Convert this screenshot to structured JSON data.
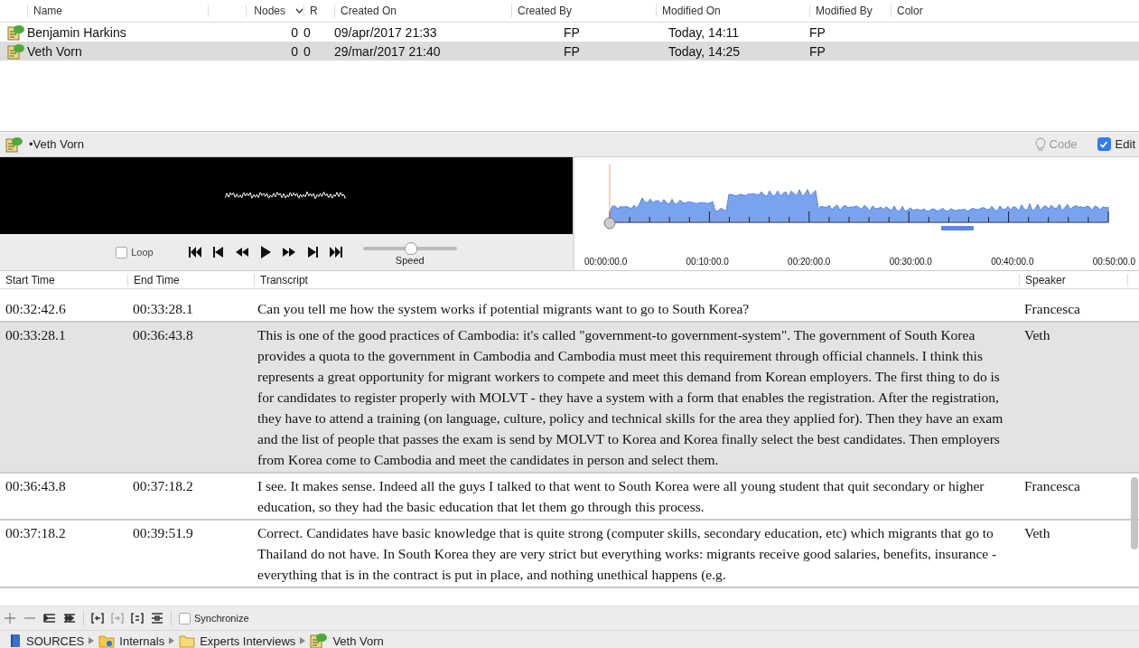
{
  "sources_table": {
    "columns": [
      {
        "label": "Name",
        "sorted": false
      },
      {
        "label": "Nodes",
        "sorted": true
      },
      {
        "label": "R",
        "sorted": false
      },
      {
        "label": "Created On",
        "sorted": false
      },
      {
        "label": "Created By",
        "sorted": false
      },
      {
        "label": "Modified On",
        "sorted": false
      },
      {
        "label": "Modified By",
        "sorted": false
      },
      {
        "label": "Color",
        "sorted": false
      }
    ],
    "rows": [
      {
        "name": "Benjamin Harkins",
        "nodes": "0",
        "r": "0",
        "created_on": "09/apr/2017 21:33",
        "created_by": "FP",
        "modified_on": "Today, 14:11",
        "modified_by": "FP",
        "selected": false
      },
      {
        "name": "Veth Vorn",
        "nodes": "0",
        "r": "0",
        "created_on": "29/mar/2017 21:40",
        "created_by": "FP",
        "modified_on": "Today, 14:25",
        "modified_by": "FP",
        "selected": true
      }
    ]
  },
  "document": {
    "title": "•Veth Vorn",
    "code": {
      "label": "Code"
    },
    "edit": {
      "label": "Edit",
      "checked": true
    }
  },
  "player": {
    "loop": {
      "label": "Loop",
      "checked": false
    },
    "speed": {
      "label": "Speed",
      "level": 0.5
    }
  },
  "timeline": {
    "labels": [
      "00:00:00.0",
      "00:10:00.0",
      "00:20:00.0",
      "00:30:00.0",
      "00:40:00.0",
      "00:50:00.0"
    ]
  },
  "transcript": {
    "columns": [
      "Start Time",
      "End Time",
      "Transcript",
      "Speaker"
    ],
    "rows": [
      {
        "start": "00:32:42.6",
        "end": "00:33:28.1",
        "text": "Can you tell me how the system works if potential migrants want to go to South Korea?",
        "speaker": "Francesca",
        "selected": false
      },
      {
        "start": "00:33:28.1",
        "end": "00:36:43.8",
        "text": "This is one of the good practices of Cambodia: it's called \"government-to government-system\". The government of South Korea provides a quota to the government in Cambodia and Cambodia must meet this requirement through official channels. I think this represents a great opportunity for migrant workers to compete and meet this demand from Korean employers. The first thing to do is for candidates to register properly with MOLVT - they have a system with a form that enables the registration. After the registration, they have to attend a training (on language, culture, policy and technical skills for the area they applied for). Then they have an exam and the list of people that passes the exam is send by MOLVT to Korea and Korea finally select the best candidates. Then employers from Korea come to Cambodia and meet the candidates in person and select them.",
        "speaker": "Veth",
        "selected": true
      },
      {
        "start": "00:36:43.8",
        "end": "00:37:18.2",
        "text": "I see. It makes sense. Indeed all the guys I talked to that went to South Korea were all young student that quit secondary or higher education, so they had the basic education that let them go through this process.",
        "speaker": "Francesca",
        "selected": false
      },
      {
        "start": "00:37:18.2",
        "end": "00:39:51.9",
        "text": "Correct. Candidates have basic knowledge that is quite strong (computer skills, secondary education, etc) which migrants that go to Thailand do not have. In South Korea they are very strict but everything works: migrants receive good salaries, benefits, insurance - everything that is in the contract is put in place, and nothing unethical happens (e.g.",
        "speaker": "Veth",
        "selected": false
      }
    ]
  },
  "toolbar": {
    "synchronize": {
      "label": "Synchronize",
      "checked": false
    }
  },
  "breadcrumb": [
    {
      "label": "SOURCES",
      "kind": "sources"
    },
    {
      "label": "Internals",
      "kind": "internals"
    },
    {
      "label": "Experts Interviews",
      "kind": "folder"
    },
    {
      "label": "Veth Vorn",
      "kind": "document"
    }
  ]
}
